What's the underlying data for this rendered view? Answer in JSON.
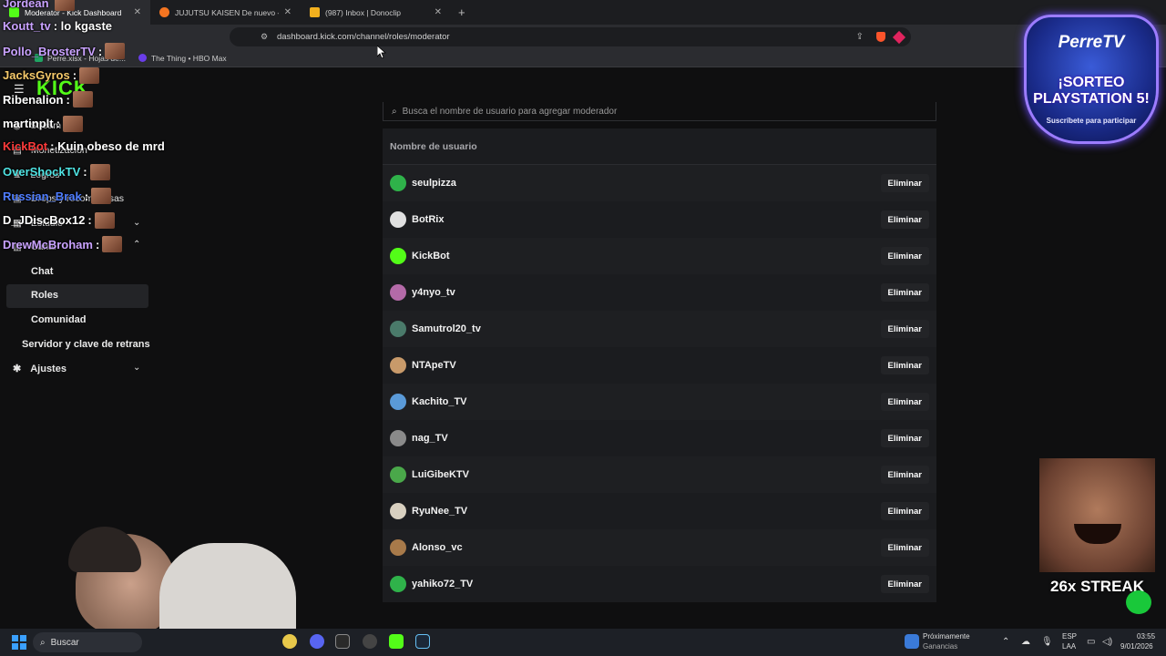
{
  "browser": {
    "tabs": [
      {
        "title": "Moderator - Kick Dashboard",
        "active": true,
        "icon": "kick-icon"
      },
      {
        "title": "JUJUTSU KAISEN De nuevo - Ver en C",
        "active": false,
        "icon": "crunchyroll-icon"
      },
      {
        "title": "(987) Inbox | Donoclip",
        "active": false,
        "icon": "donoclip-icon"
      }
    ],
    "url": "dashboard.kick.com/channel/roles/moderator",
    "bookmarks": [
      "Perre.xlsx - Hojas de...",
      "The Thing • HBO Max"
    ]
  },
  "sidebar": {
    "logo": "KICK",
    "items": [
      {
        "label": "Stream"
      },
      {
        "label": "Monetización"
      },
      {
        "label": "Logros"
      },
      {
        "label": "Drops y recompensas"
      },
      {
        "label": "Estudio"
      },
      {
        "label": "Canal"
      }
    ],
    "canal_subitems": [
      "Chat",
      "Roles",
      "Comunidad"
    ],
    "server_key": "Servidor y clave de retrans",
    "settings": "Ajustes"
  },
  "moderators": {
    "search_placeholder": "Busca el nombre de usuario para agregar moderador",
    "column_header": "Nombre de usuario",
    "remove_label": "Eliminar",
    "users": [
      {
        "name": "seulpizza",
        "avatar_color": "#2fb24a"
      },
      {
        "name": "BotRix",
        "avatar_color": "#e0e0e0"
      },
      {
        "name": "KickBot",
        "avatar_color": "#53fc18"
      },
      {
        "name": "y4nyo_tv",
        "avatar_color": "#b46aa8"
      },
      {
        "name": "Samutrol20_tv",
        "avatar_color": "#4a7a6a"
      },
      {
        "name": "NTApeTV",
        "avatar_color": "#c89a6a"
      },
      {
        "name": "Kachito_TV",
        "avatar_color": "#5a9ad8"
      },
      {
        "name": "nag_TV",
        "avatar_color": "#8a8a8a"
      },
      {
        "name": "LuiGibeKTV",
        "avatar_color": "#4aa84a"
      },
      {
        "name": "RyuNee_TV",
        "avatar_color": "#d8d0c0"
      },
      {
        "name": "Alonso_vc",
        "avatar_color": "#a87a4a"
      },
      {
        "name": "yahiko72_TV",
        "avatar_color": "#2fb24a"
      }
    ]
  },
  "chat_overlay": [
    {
      "user": "Jordean",
      "message": "",
      "color": "#c9a2ff"
    },
    {
      "user": "Koutt_tv",
      "message": ": lo kgaste",
      "color": "#c9a2ff"
    },
    {
      "user": "Pollo_BrosterTV",
      "message": ":",
      "color": "#c9a2ff"
    },
    {
      "user": "JacksGyros",
      "message": ":",
      "color": "#f5c96a"
    },
    {
      "user": "Ribenalion",
      "message": ":",
      "color": "#ffffff"
    },
    {
      "user": "martinplt",
      "message": ":",
      "color": "#ffffff"
    },
    {
      "user": "KickBot",
      "message": ": Kuin obeso de mrd",
      "color": "#ff3b3b"
    },
    {
      "user": "OverShockTV",
      "message": ":",
      "color": "#4fe3e3"
    },
    {
      "user": "Russian_Brak",
      "message": ":",
      "color": "#4f7dff"
    },
    {
      "user": "D_JDiscBox12",
      "message": ":",
      "color": "#ffffff"
    },
    {
      "user": "DrewMcBroham",
      "message": ":",
      "color": "#c9a2ff"
    }
  ],
  "promo": {
    "brand": "PerreTV",
    "headline": "¡SORTEO PLAYSTATION 5!",
    "cta": "Suscríbete para participar"
  },
  "streak": {
    "label": "26x STREAK"
  },
  "taskbar": {
    "search": "Buscar",
    "news_title": "Próximamente",
    "news_sub": "Ganancias",
    "lang": "ESP",
    "lang2": "LAA",
    "time": "03:55",
    "date": "9/01/2026"
  }
}
